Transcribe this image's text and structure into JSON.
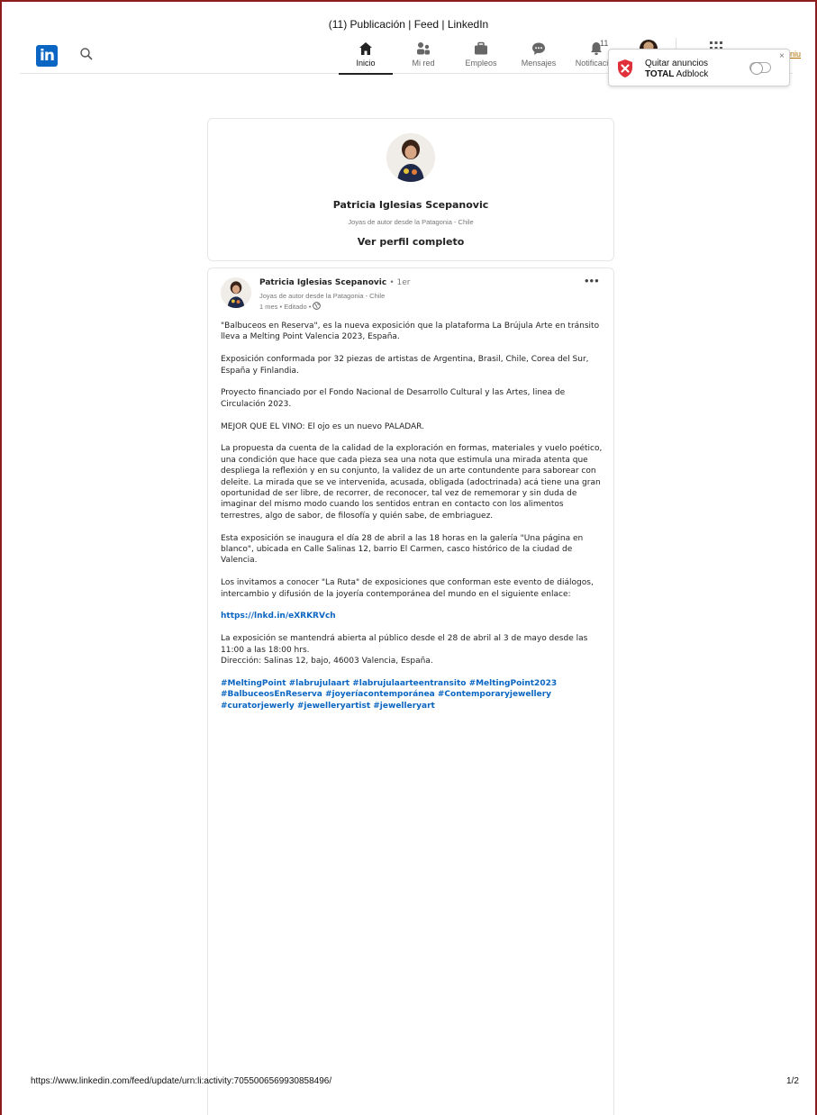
{
  "print": {
    "title": "(11) Publicación | Feed | LinkedIn",
    "url": "https://www.linkedin.com/feed/update/urn:li:activity:7055006569930858496/",
    "page": "1/2"
  },
  "header": {
    "logo_text": "in",
    "nav": [
      {
        "label": "Inicio",
        "icon": "home-icon"
      },
      {
        "label": "Mi red",
        "icon": "network-icon"
      },
      {
        "label": "Empleos",
        "icon": "briefcase-icon"
      },
      {
        "label": "Mensajes",
        "icon": "message-icon"
      },
      {
        "label": "Notificacion",
        "icon": "bell-icon",
        "badge": "11"
      }
    ],
    "premium_text": "niu"
  },
  "adblock": {
    "line1": "Quitar anuncios",
    "brand": "TOTAL",
    "product": "Adblock",
    "close": "×"
  },
  "profile": {
    "name": "Patricia Iglesias Scepanovic",
    "headline": "Joyas de autor desde la Patagonia - Chile",
    "view_full": "Ver perfil completo"
  },
  "post": {
    "author": "Patricia Iglesias Scepanovic",
    "degree": "• 1er",
    "headline": "Joyas de autor desde la Patagonia - Chile",
    "time": "1 mes • Editado •",
    "more": "•••",
    "paragraphs": [
      "\"Balbuceos en Reserva\", es la nueva exposición que la plataforma La Brújula Arte en tránsito lleva a Melting Point Valencia 2023, España.",
      "Exposición conformada por 32 piezas de artistas de Argentina, Brasil, Chile, Corea del Sur, España y Finlandia.",
      "Proyecto financiado por el Fondo Nacional de Desarrollo Cultural y las Artes, linea de Circulación 2023.",
      "MEJOR QUE EL VINO: El ojo es un nuevo PALADAR.",
      "La propuesta da cuenta de la calidad de la exploración en formas, materiales y vuelo poético, una condición que hace que cada pieza sea una nota que estimula una mirada atenta que despliega la reflexión y en su conjunto, la validez de un arte contundente para saborear con deleite. La mirada que se ve intervenida, acusada, obligada (adoctrinada) acá tiene una gran oportunidad de ser libre, de recorrer, de reconocer, tal vez de rememorar y sin duda de imaginar del mismo modo cuando los sentidos entran en contacto con los alimentos terrestres, algo de sabor, de filosofía y quién sabe, de embriaguez.",
      "Esta exposición se inaugura el día 28 de abril a las 18 horas en la galería \"Una página en blanco\", ubicada en Calle Salinas 12, barrio El Carmen, casco histórico de la ciudad de Valencia.",
      "Los invitamos a conocer \"La Ruta\" de exposiciones que conforman este evento de diálogos, intercambio y difusión de la joyería contemporánea del mundo en el siguiente enlace:"
    ],
    "link": "https://lnkd.in/eXRKRVch",
    "closing_lines": [
      "La exposición se mantendrá abierta al público desde el 28 de abril al 3 de mayo desde las 11:00 a las 18:00 hrs.",
      "Dirección: Salinas 12, bajo, 46003 Valencia, España."
    ],
    "hashtags": "#MeltingPoint #labrujulaart #labrujulaarteentransito #MeltingPoint2023 #BalbuceosEnReserva #joyeríacontemporánea #Contemporaryjewellery #curatorjewerly #jewelleryartist #jewelleryart"
  },
  "colors": {
    "linkedin_blue": "#0a66c2",
    "frame": "#8b1d1d",
    "adblock_red": "#e0303a"
  }
}
